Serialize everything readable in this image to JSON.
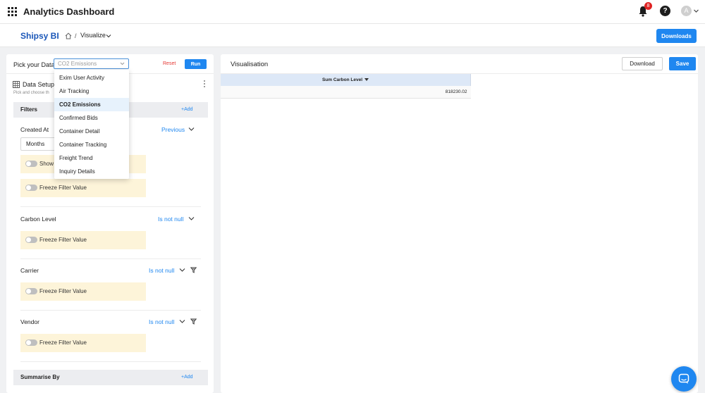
{
  "topbar": {
    "title": "Analytics Dashboard",
    "notification_count": "8",
    "help_glyph": "?",
    "avatar_initial": "A"
  },
  "subbar": {
    "brand": "Shipsy BI",
    "breadcrumb_separator": "/",
    "breadcrumb_current": "Visualize",
    "downloads_label": "Downloads"
  },
  "data_panel": {
    "pick_label": "Pick your Data",
    "selected_dataset": "CO2 Emissions",
    "reset_label": "Reset",
    "run_label": "Run",
    "setup_title": "Data Setup",
    "setup_subtitle": "Pick and choose th"
  },
  "dropdown": {
    "options": [
      "Exim User Activity",
      "Air Tracking",
      "CO2 Emissions",
      "Confirmed Bids",
      "Container Detail",
      "Container Tracking",
      "Freight Trend",
      "Inquiry Details"
    ],
    "selected": "CO2 Emissions"
  },
  "filters": {
    "title": "Filters",
    "add_label": "+Add",
    "items": [
      {
        "label": "Created At",
        "condition": "Previous",
        "period": "Months",
        "show_label": "Show",
        "freeze_label": "Freeze Filter Value"
      },
      {
        "label": "Carbon Level",
        "condition": "Is not null",
        "freeze_label": "Freeze Filter Value"
      },
      {
        "label": "Carrier",
        "condition": "Is not null",
        "freeze_label": "Freeze Filter Value"
      },
      {
        "label": "Vendor",
        "condition": "Is not null",
        "freeze_label": "Freeze Filter Value"
      }
    ]
  },
  "summarise": {
    "title": "Summarise By",
    "add_label": "+Add"
  },
  "visualisation": {
    "title": "Visualisation",
    "download_label": "Download",
    "save_label": "Save",
    "table": {
      "columns": [
        "Sum Carbon Level"
      ],
      "rows": [
        [
          "818230.02"
        ]
      ]
    }
  },
  "colors": {
    "accent": "#1f87f0",
    "brand": "#1a56b8",
    "danger": "#e53935",
    "freeze_bg": "#fdf4d9"
  },
  "icons": {
    "apps": "grid-icon",
    "notifications": "bell-icon",
    "help": "help-icon",
    "home": "home-icon",
    "chat": "chat-icon"
  }
}
